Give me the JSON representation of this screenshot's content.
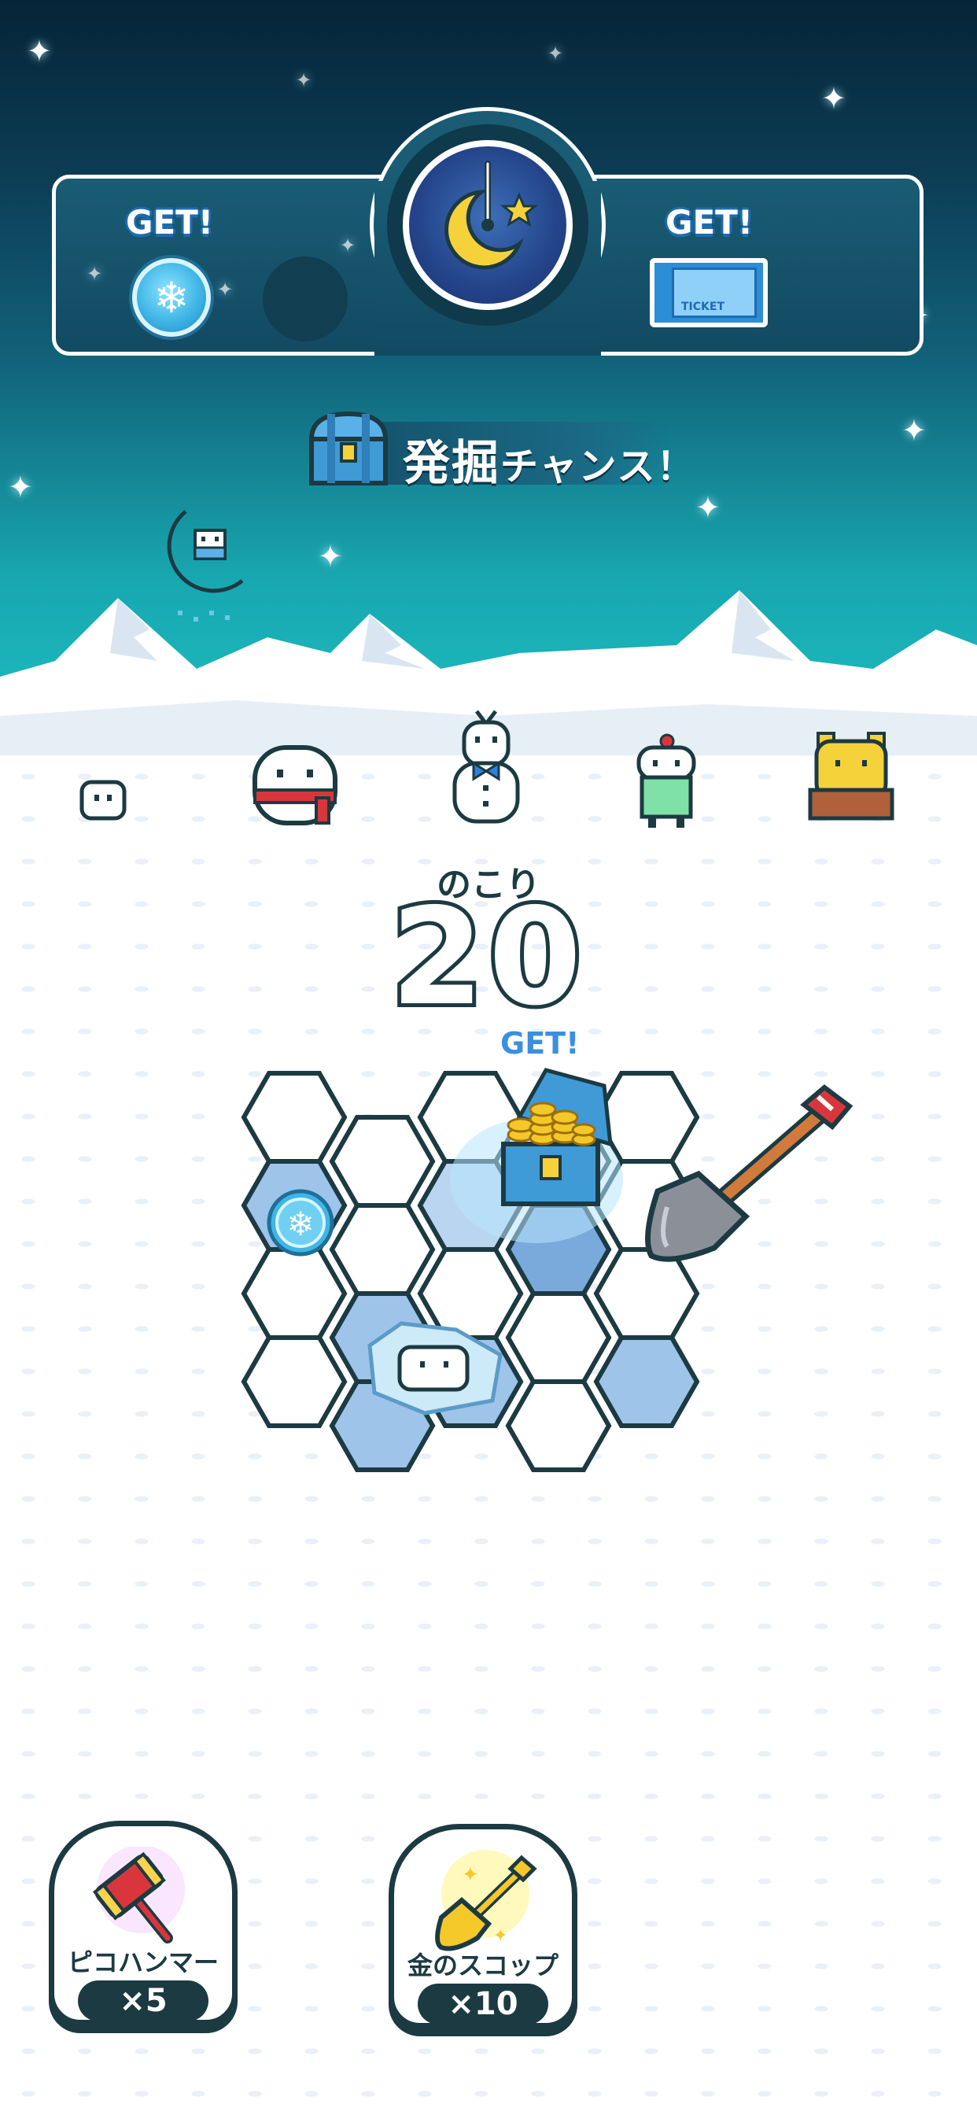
{
  "header": {
    "left_get_label": "GET!",
    "right_get_label": "GET!",
    "ticket_text": "TICKET"
  },
  "banner": {
    "title_main": "発掘",
    "title_sub": "チャンス！"
  },
  "counter": {
    "label": "のこり",
    "remaining": "20"
  },
  "board": {
    "get_label": "GET!"
  },
  "items": [
    {
      "label": "ピコハンマー",
      "count": "×5",
      "icon": "hammer-icon"
    },
    {
      "label": "金のスコップ",
      "count": "×10",
      "icon": "gold-shovel-icon"
    }
  ],
  "colors": {
    "accent": "#1c3a42",
    "sky_top": "#062437",
    "sky_bottom": "#1dc6c6",
    "get_blue": "#3a8fe0"
  }
}
